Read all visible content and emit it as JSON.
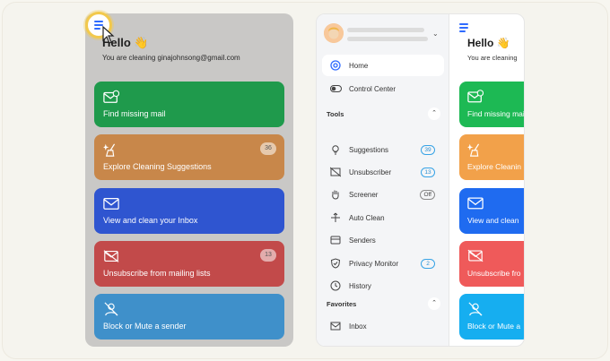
{
  "left_screen": {
    "greeting": "Hello 👋",
    "subtitle": "You are cleaning ginajohnsong@gmail.com",
    "cards": [
      {
        "label": "Find missing mail",
        "color": "#1f9a4c",
        "icon": "mail-question-icon",
        "badge": ""
      },
      {
        "label": "Explore Cleaning Suggestions",
        "color": "#c8874a",
        "icon": "broom-sparkle-icon",
        "badge": "36"
      },
      {
        "label": "View and clean your Inbox",
        "color": "#2f55d0",
        "icon": "envelope-icon",
        "badge": ""
      },
      {
        "label": "Unsubscribe from mailing lists",
        "color": "#c24a4a",
        "icon": "mail-off-icon",
        "badge": "13"
      },
      {
        "label": "Block or Mute a sender",
        "color": "#3f90ca",
        "icon": "user-block-icon",
        "badge": ""
      }
    ]
  },
  "sidebar": {
    "nav": [
      {
        "label": "Home",
        "icon": "at-icon",
        "active": true
      },
      {
        "label": "Control Center",
        "icon": "toggle-icon",
        "active": false
      }
    ],
    "tools_header": "Tools",
    "tools": [
      {
        "label": "Suggestions",
        "icon": "bulb-icon",
        "badge": "39",
        "badge_style": "blue"
      },
      {
        "label": "Unsubscriber",
        "icon": "mail-off-icon",
        "badge": "13",
        "badge_style": "blue"
      },
      {
        "label": "Screener",
        "icon": "hand-icon",
        "badge": "Off",
        "badge_style": "grey"
      },
      {
        "label": "Auto Clean",
        "icon": "auto-clean-icon",
        "badge": "",
        "badge_style": ""
      },
      {
        "label": "Senders",
        "icon": "senders-icon",
        "badge": "",
        "badge_style": ""
      },
      {
        "label": "Privacy Monitor",
        "icon": "shield-icon",
        "badge": "2",
        "badge_style": "blue"
      },
      {
        "label": "History",
        "icon": "clock-icon",
        "badge": "",
        "badge_style": ""
      }
    ],
    "favorites_header": "Favorites",
    "favorites": [
      {
        "label": "Inbox",
        "icon": "inbox-icon"
      }
    ]
  },
  "right_screen": {
    "greeting": "Hello 👋",
    "subtitle": "You are cleaning",
    "cards": [
      {
        "label": "Find missing mail",
        "color": "#1db954"
      },
      {
        "label": "Explore Cleanin",
        "color": "#f2a14a"
      },
      {
        "label": "View and clean",
        "color": "#1f6bf0"
      },
      {
        "label": "Unsubscribe fro",
        "color": "#ef5a5a"
      },
      {
        "label": "Block or Mute a",
        "color": "#16aef0"
      }
    ]
  }
}
